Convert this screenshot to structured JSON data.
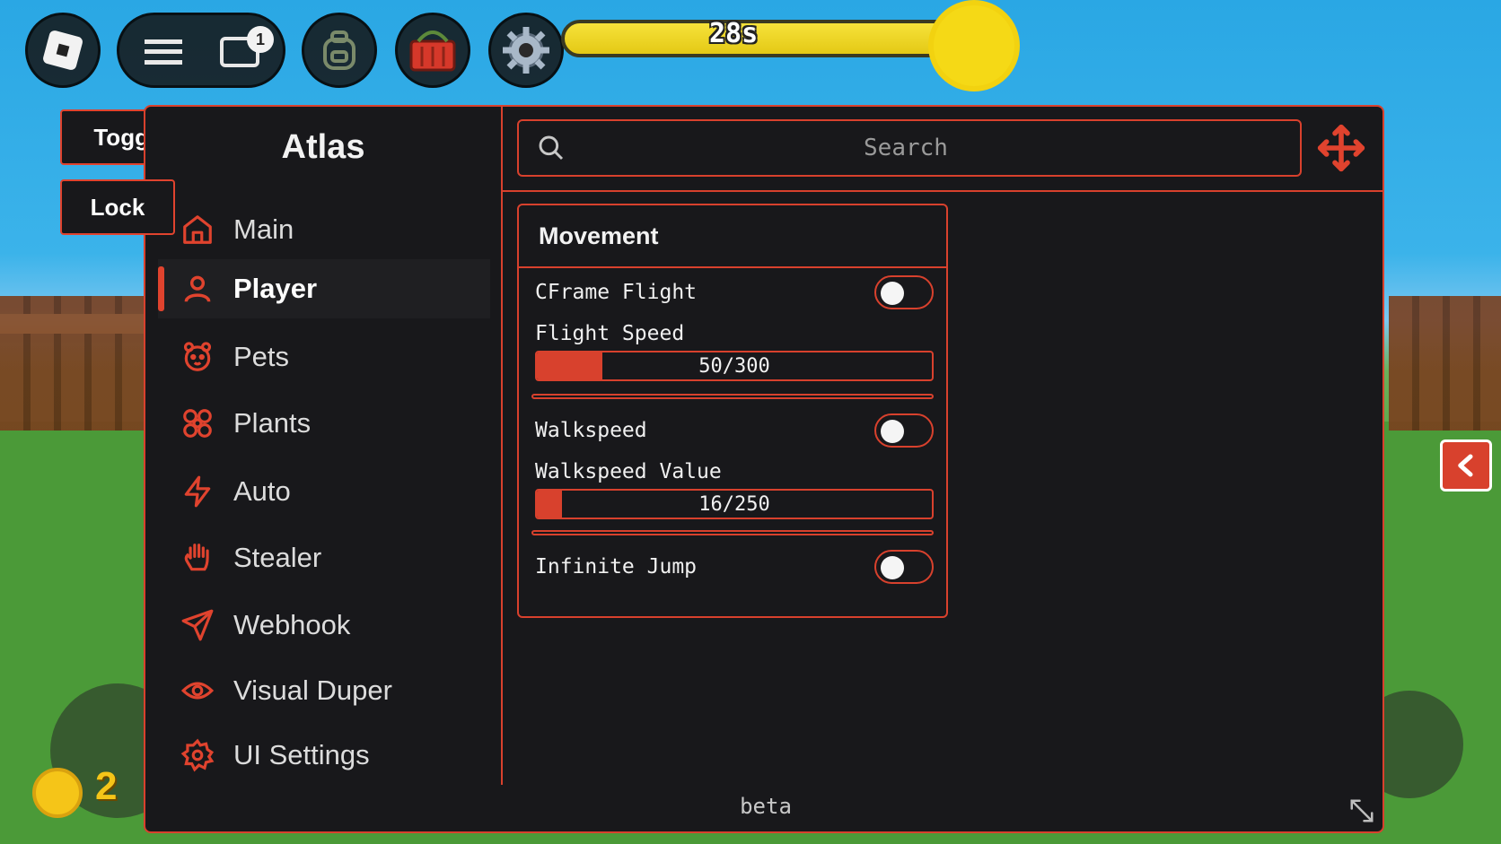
{
  "hud": {
    "chat_badge": "1",
    "timer_text": "28s"
  },
  "side_buttons": {
    "toggle_label": "Toggle",
    "lock_label": "Lock"
  },
  "window": {
    "title": "Atlas",
    "search_placeholder": "Search",
    "footer": "beta",
    "nav": [
      {
        "label": "Main",
        "icon": "home-icon"
      },
      {
        "label": "Player",
        "icon": "user-icon",
        "active": true
      },
      {
        "label": "Pets",
        "icon": "paw-icon"
      },
      {
        "label": "Plants",
        "icon": "flower-icon"
      },
      {
        "label": "Auto",
        "icon": "lightning-icon"
      },
      {
        "label": "Stealer",
        "icon": "hand-icon"
      },
      {
        "label": "Webhook",
        "icon": "send-icon"
      },
      {
        "label": "Visual Duper",
        "icon": "eye-icon"
      },
      {
        "label": "UI Settings",
        "icon": "gear-icon"
      }
    ],
    "movement": {
      "title": "Movement",
      "cframe_flight_label": "CFrame Flight",
      "cframe_flight_on": false,
      "flight_speed_label": "Flight Speed",
      "flight_speed_value": 50,
      "flight_speed_max": 300,
      "flight_speed_text": "50/300",
      "walkspeed_label": "Walkspeed",
      "walkspeed_on": false,
      "walkspeed_value_label": "Walkspeed Value",
      "walkspeed_value": 16,
      "walkspeed_max": 250,
      "walkspeed_text": "16/250",
      "infinite_jump_label": "Infinite Jump",
      "infinite_jump_on": false
    }
  },
  "game": {
    "coin_count": "2"
  },
  "colors": {
    "accent": "#d8412d",
    "panel_bg": "#18181b"
  }
}
